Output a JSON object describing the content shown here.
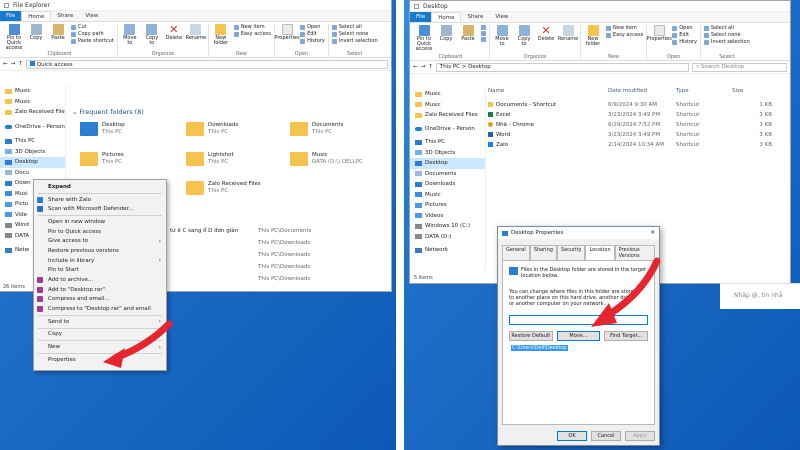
{
  "left": {
    "title": "File Explorer",
    "tabs": [
      "File",
      "Home",
      "Share",
      "View"
    ],
    "ribbon": {
      "pin": "Pin to Quick access",
      "copy": "Copy",
      "paste": "Paste",
      "cut": "Cut",
      "copy_path": "Copy path",
      "paste_shortcut": "Paste shortcut",
      "clipboard": "Clipboard",
      "move_to": "Move to",
      "copy_to": "Copy to",
      "delete": "Delete",
      "rename": "Rename",
      "organize": "Organize",
      "new_folder": "New folder",
      "new_item": "New item",
      "easy_access": "Easy access",
      "new": "New",
      "properties": "Properties",
      "open": "Open",
      "edit": "Edit",
      "history": "History",
      "open_group": "Open",
      "select_all": "Select all",
      "select_none": "Select none",
      "invert_selection": "Invert selection",
      "select": "Select"
    },
    "address": "Quick access",
    "nav": [
      "Music",
      "Music",
      "Zalo Received File",
      "OneDrive - Person",
      "This PC",
      "3D Objects",
      "Desktop",
      "Docu",
      "Down",
      "Musi",
      "Pictu",
      "Vide",
      "Wind",
      "DATA",
      "Netw"
    ],
    "status": "26 items",
    "group_header": "Frequent folders (8)",
    "folders": [
      {
        "name": "Desktop",
        "sub": "This PC"
      },
      {
        "name": "Downloads",
        "sub": "This PC"
      },
      {
        "name": "Documents",
        "sub": "This PC"
      },
      {
        "name": "Pictures",
        "sub": "This PC"
      },
      {
        "name": "Lightshot",
        "sub": "This PC"
      },
      {
        "name": "Music",
        "sub": "DATA (D:\\) DELLPC"
      },
      {
        "name": "Zalo Received Files",
        "sub": "This PC"
      }
    ],
    "recent_snippet": "tử ế C sang ổ D đơn giản",
    "recent_paths": [
      "This PC\\Documents",
      "This PC\\Downloads",
      "This PC\\Downloads",
      "This PC\\Downloads",
      "This PC\\Downloads"
    ],
    "menu": [
      "Expand",
      "Share with Zalo",
      "Scan with Microsoft Defender...",
      "Open in new window",
      "Pin to Quick access",
      "Give access to",
      "Restore previous versions",
      "Include in library",
      "Pin to Start",
      "Add to archive...",
      "Add to \"Desktop.rar\"",
      "Compress and email...",
      "Compress to \"Desktop.rar\" and email",
      "Send to",
      "Copy",
      "New",
      "Properties"
    ]
  },
  "right": {
    "title": "Desktop",
    "tabs": [
      "File",
      "Home",
      "Share",
      "View"
    ],
    "ribbon": {
      "pin": "Pin to Quick access",
      "copy": "Copy",
      "paste": "Paste",
      "clipboard": "Clipboard",
      "move_to": "Move to",
      "copy_to": "Copy to",
      "delete": "Delete",
      "rename": "Rename",
      "organize": "Organize",
      "new_folder": "New folder",
      "new_item": "New item",
      "easy_access": "Easy access",
      "new": "New",
      "properties": "Properties",
      "open": "Open",
      "edit": "Edit",
      "history": "History",
      "open_group": "Open",
      "select_all": "Select all",
      "select_none": "Select none",
      "invert_selection": "Invert selection",
      "select": "Select"
    },
    "address": "This PC > Desktop",
    "search": "Search Desktop",
    "columns": [
      "Name",
      "Date modified",
      "Type",
      "Size"
    ],
    "files": [
      {
        "name": "Documents - Shortcut",
        "date": "6/9/2024 9:30 AM",
        "type": "Shortcut",
        "size": "1 KB"
      },
      {
        "name": "Excel",
        "date": "3/23/2024 3:49 PM",
        "type": "Shortcut",
        "size": "3 KB"
      },
      {
        "name": "Nhã - Chrome",
        "date": "6/29/2024 7:52 PM",
        "type": "Shortcut",
        "size": "3 KB"
      },
      {
        "name": "Word",
        "date": "3/23/2024 3:49 PM",
        "type": "Shortcut",
        "size": "3 KB"
      },
      {
        "name": "Zalo",
        "date": "2/14/2024 10:34 AM",
        "type": "Shortcut",
        "size": "3 KB"
      }
    ],
    "nav": [
      "Music",
      "Music",
      "Zalo Received Files",
      "OneDrive - Person",
      "This PC",
      "3D Objects",
      "Desktop",
      "Documents",
      "Downloads",
      "Music",
      "Pictures",
      "Videos",
      "Windows 10 (C:)",
      "DATA (D:)",
      "Network"
    ],
    "status": "5 items",
    "chat_hint": "Nhập @, tin nhắ",
    "dialog": {
      "title": "Desktop Properties",
      "tabs": [
        "General",
        "Sharing",
        "Security",
        "Location",
        "Previous Versions"
      ],
      "info": "Files in the Desktop folder are stored in the target location below.",
      "desc": "You can change where files in this folder are stored to another place on this hard drive, another drive, or another computer on your network.",
      "path": "C:\\Users\\Dell\\Desktop",
      "restore": "Restore Default",
      "move": "Move...",
      "find": "Find Target...",
      "ok": "OK",
      "cancel": "Cancel",
      "apply": "Apply"
    }
  },
  "colors": {
    "desktop": "#1f6fc8",
    "file_tab": "#1979ca",
    "selection": "#cce8ff",
    "arrow": "#e5262e",
    "folder": "#f4c44e"
  }
}
